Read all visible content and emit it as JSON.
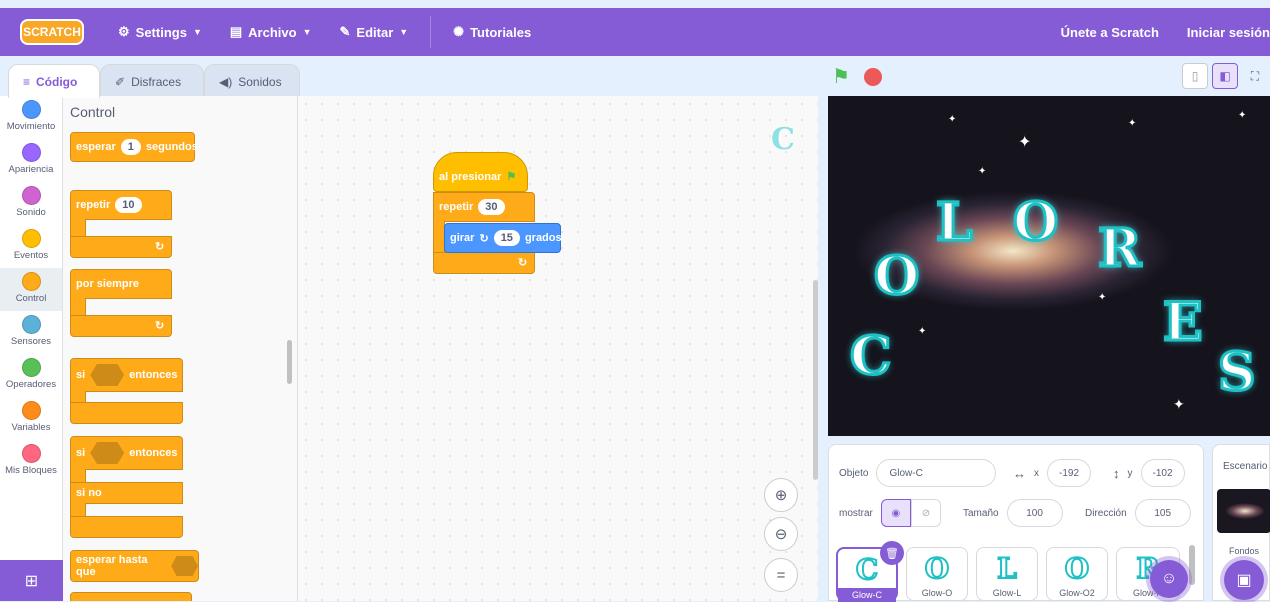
{
  "menubar": {
    "logo": "SCRATCH",
    "settings": "Settings",
    "file": "Archivo",
    "edit": "Editar",
    "tutorials": "Tutoriales",
    "join": "Únete a Scratch",
    "signin": "Iniciar sesión"
  },
  "tabs": {
    "code": "Código",
    "costumes": "Disfraces",
    "sounds": "Sonidos"
  },
  "categories": [
    {
      "label": "Movimiento",
      "color": "#4c97ff"
    },
    {
      "label": "Apariencia",
      "color": "#9966ff"
    },
    {
      "label": "Sonido",
      "color": "#cf63cf"
    },
    {
      "label": "Eventos",
      "color": "#ffbf00"
    },
    {
      "label": "Control",
      "color": "#ffab19"
    },
    {
      "label": "Sensores",
      "color": "#5cb1d6"
    },
    {
      "label": "Operadores",
      "color": "#59c059"
    },
    {
      "label": "Variables",
      "color": "#ff8c1a"
    },
    {
      "label": "Mis Bloques",
      "color": "#ff6680"
    }
  ],
  "palette": {
    "title": "Control",
    "wait": "esperar",
    "wait_value": "1",
    "wait_unit": "segundos",
    "repeat": "repetir",
    "repeat_value": "10",
    "forever": "por siempre",
    "if1": "si",
    "then1": "entonces",
    "if2": "si",
    "then2": "entonces",
    "else": "si no",
    "wait_until": "esperar hasta que"
  },
  "script": {
    "hat": "al presionar",
    "repeat": "repetir",
    "repeat_value": "30",
    "turn": "girar",
    "turn_value": "15",
    "turn_unit": "grados"
  },
  "stage_letters": [
    "C",
    "O",
    "L",
    "O",
    "R",
    "E",
    "S"
  ],
  "sprite_info": {
    "object_label": "Objeto",
    "object_value": "Glow-C",
    "x_label": "x",
    "x_value": "-192",
    "y_label": "y",
    "y_value": "-102",
    "show_label": "mostrar",
    "size_label": "Tamaño",
    "size_value": "100",
    "direction_label": "Dirección",
    "direction_value": "105"
  },
  "sprites": [
    {
      "glyph": "C",
      "label": "Glow-C"
    },
    {
      "glyph": "O",
      "label": "Glow-O"
    },
    {
      "glyph": "L",
      "label": "Glow-L"
    },
    {
      "glyph": "O",
      "label": "Glow-O2"
    },
    {
      "glyph": "R",
      "label": "Glow-R"
    }
  ],
  "stage_panel": {
    "title": "Escenario",
    "backdrops": "Fondos"
  },
  "colors": {
    "brand": "#855cd6",
    "control": "#ffab19",
    "motion": "#4c97ff",
    "glow": "#1fc1c4"
  }
}
